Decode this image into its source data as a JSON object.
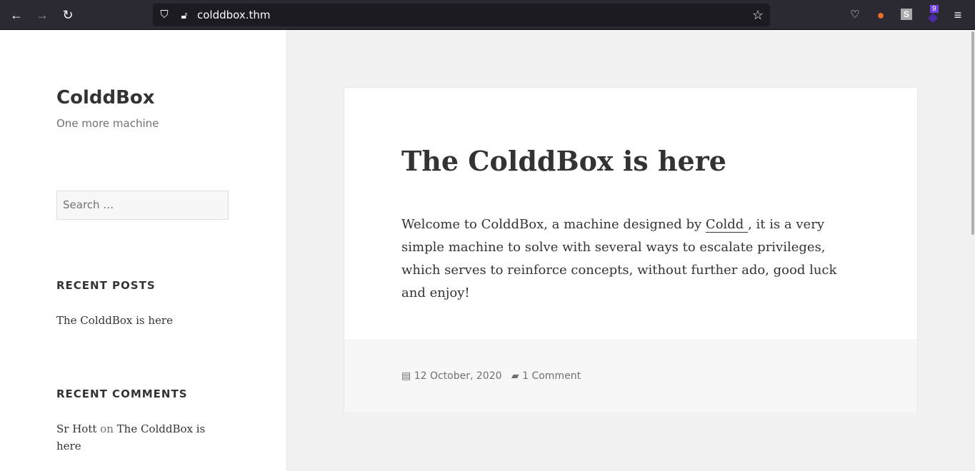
{
  "browser": {
    "url": "colddbox.thm",
    "extension_badge": "9"
  },
  "site": {
    "title": "ColddBox",
    "tagline": "One more machine",
    "search_placeholder": "Search …"
  },
  "widgets": {
    "recent_posts_title": "RECENT POSTS",
    "recent_posts": [
      "The ColddBox is here"
    ],
    "recent_comments_title": "RECENT COMMENTS",
    "comment_author": "Sr Hott",
    "comment_on": "on",
    "comment_post": "The ColddBox is here"
  },
  "post": {
    "title": "The ColddBox is here",
    "body_before": "Welcome to ColddBox, a machine designed by ",
    "link": "Coldd ",
    "body_after": ", it is a very simple machine to solve with several ways to escalate privileges, which serves to reinforce concepts, without further ado, good luck and enjoy!",
    "date": "12 October, 2020",
    "comments": "1 Comment"
  }
}
